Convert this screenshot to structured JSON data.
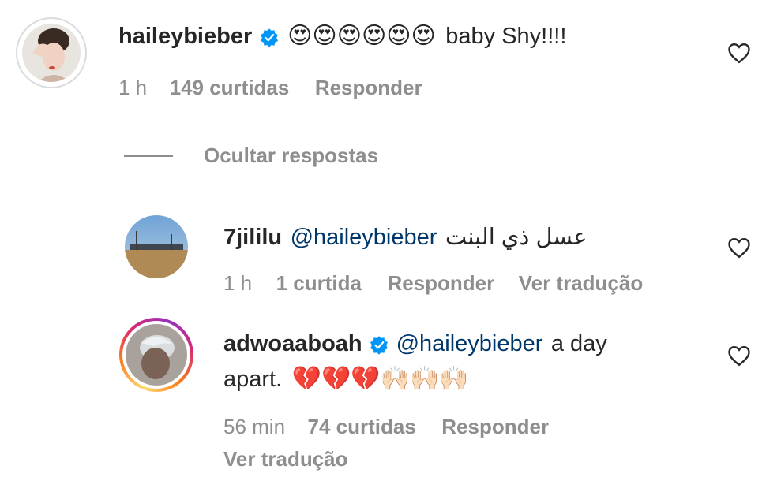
{
  "comment": {
    "username": "haileybieber",
    "verified": true,
    "emojis": "😍😍😍😍😍😍",
    "text": "baby Shy!!!!",
    "time": "1 h",
    "likes": "149 curtidas",
    "reply_label": "Responder"
  },
  "hide_replies_label": "Ocultar respostas",
  "replies": [
    {
      "username": "7jililu",
      "mention": "@haileybieber",
      "text": "عسل ذي البنت",
      "time": "1 h",
      "likes": "1 curtida",
      "reply_label": "Responder",
      "translate_label": "Ver tradução"
    },
    {
      "username": "adwoaaboah",
      "verified": true,
      "mention": "@haileybieber",
      "text_line1": "a day",
      "text_line2": "apart.",
      "emojis": "💔💔💔🙌🏻🙌🏻🙌🏻",
      "time": "56 min",
      "likes": "74 curtidas",
      "reply_label": "Responder",
      "translate_label": "Ver tradução"
    }
  ],
  "colors": {
    "text": "#262626",
    "meta": "#8e8e8e",
    "mention": "#00376b",
    "verified": "#0095f6",
    "story_ring_start": "#feda75",
    "story_ring_end": "#d62976"
  },
  "icons": [
    "verified-badge-icon",
    "heart-outline-icon"
  ]
}
